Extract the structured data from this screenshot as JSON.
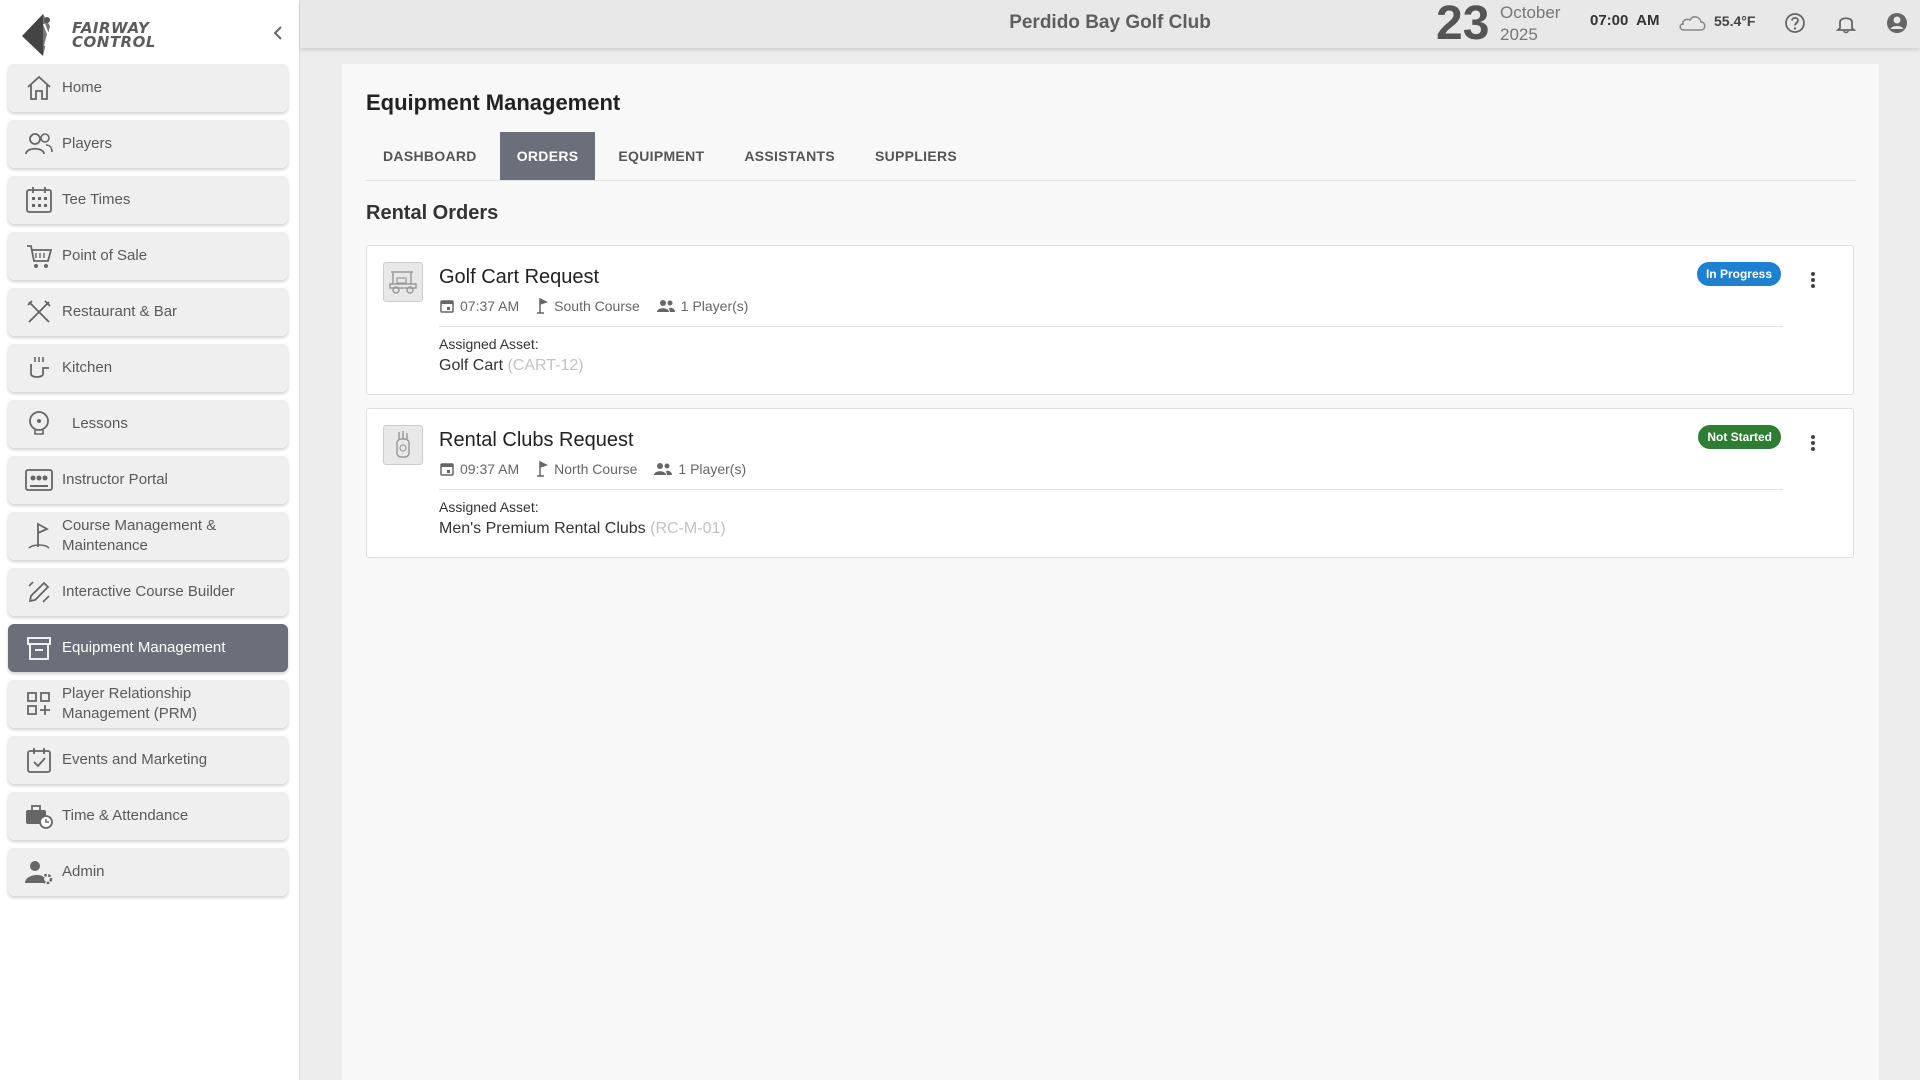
{
  "app": {
    "logo_line1": "FAIRWAY",
    "logo_line2": "CONTROL"
  },
  "sidebar": {
    "items": [
      {
        "label": "Home",
        "icon": "home-icon"
      },
      {
        "label": "Players",
        "icon": "players-icon"
      },
      {
        "label": "Tee Times",
        "icon": "calendar-grid-icon"
      },
      {
        "label": "Point of Sale",
        "icon": "cart-icon"
      },
      {
        "label": "Restaurant & Bar",
        "icon": "utensils-icon"
      },
      {
        "label": "Kitchen",
        "icon": "kitchen-icon"
      },
      {
        "label": "Lessons",
        "icon": "lightbulb-icon"
      },
      {
        "label": "Instructor Portal",
        "icon": "instructor-icon"
      },
      {
        "label": "Course Management & Maintenance",
        "icon": "flag-icon"
      },
      {
        "label": "Interactive Course Builder",
        "icon": "pencil-ruler-icon"
      },
      {
        "label": "Equipment Management",
        "icon": "archive-box-icon",
        "active": true
      },
      {
        "label": "Player Relationship Management (PRM)",
        "icon": "grid-plus-icon"
      },
      {
        "label": "Events and Marketing",
        "icon": "calendar-check-icon"
      },
      {
        "label": "Time & Attendance",
        "icon": "briefcase-clock-icon"
      },
      {
        "label": "Admin",
        "icon": "user-gear-icon"
      }
    ]
  },
  "header": {
    "club_name": "Perdido Bay Golf Club",
    "day": "23",
    "month": "October",
    "year": "2025",
    "time": "07:00  AM",
    "temperature": "55.4°F",
    "weather_icon": "cloud-icon"
  },
  "main": {
    "page_title": "Equipment Management",
    "tabs": [
      {
        "label": "DASHBOARD"
      },
      {
        "label": "ORDERS",
        "active": true
      },
      {
        "label": "EQUIPMENT"
      },
      {
        "label": "ASSISTANTS"
      },
      {
        "label": "SUPPLIERS"
      }
    ],
    "section_title": "Rental Orders",
    "orders": [
      {
        "title": "Golf Cart Request",
        "time": "07:37 AM",
        "course": "South Course",
        "players": "1 Player(s)",
        "assigned_label": "Assigned Asset:",
        "asset_name": "Golf Cart",
        "asset_code": "(CART-12)",
        "status": "In Progress",
        "status_color": "#1e80d0"
      },
      {
        "title": "Rental Clubs Request",
        "time": "09:37 AM",
        "course": "North Course",
        "players": "1 Player(s)",
        "assigned_label": "Assigned Asset:",
        "asset_name": "Men's Premium Rental Clubs",
        "asset_code": "(RC-M-01)",
        "status": "Not Started",
        "status_color": "#2e7d32"
      }
    ]
  },
  "colors": {
    "active_nav": "#6b6f79",
    "in_progress": "#1e80d0",
    "not_started": "#2e7d32"
  }
}
